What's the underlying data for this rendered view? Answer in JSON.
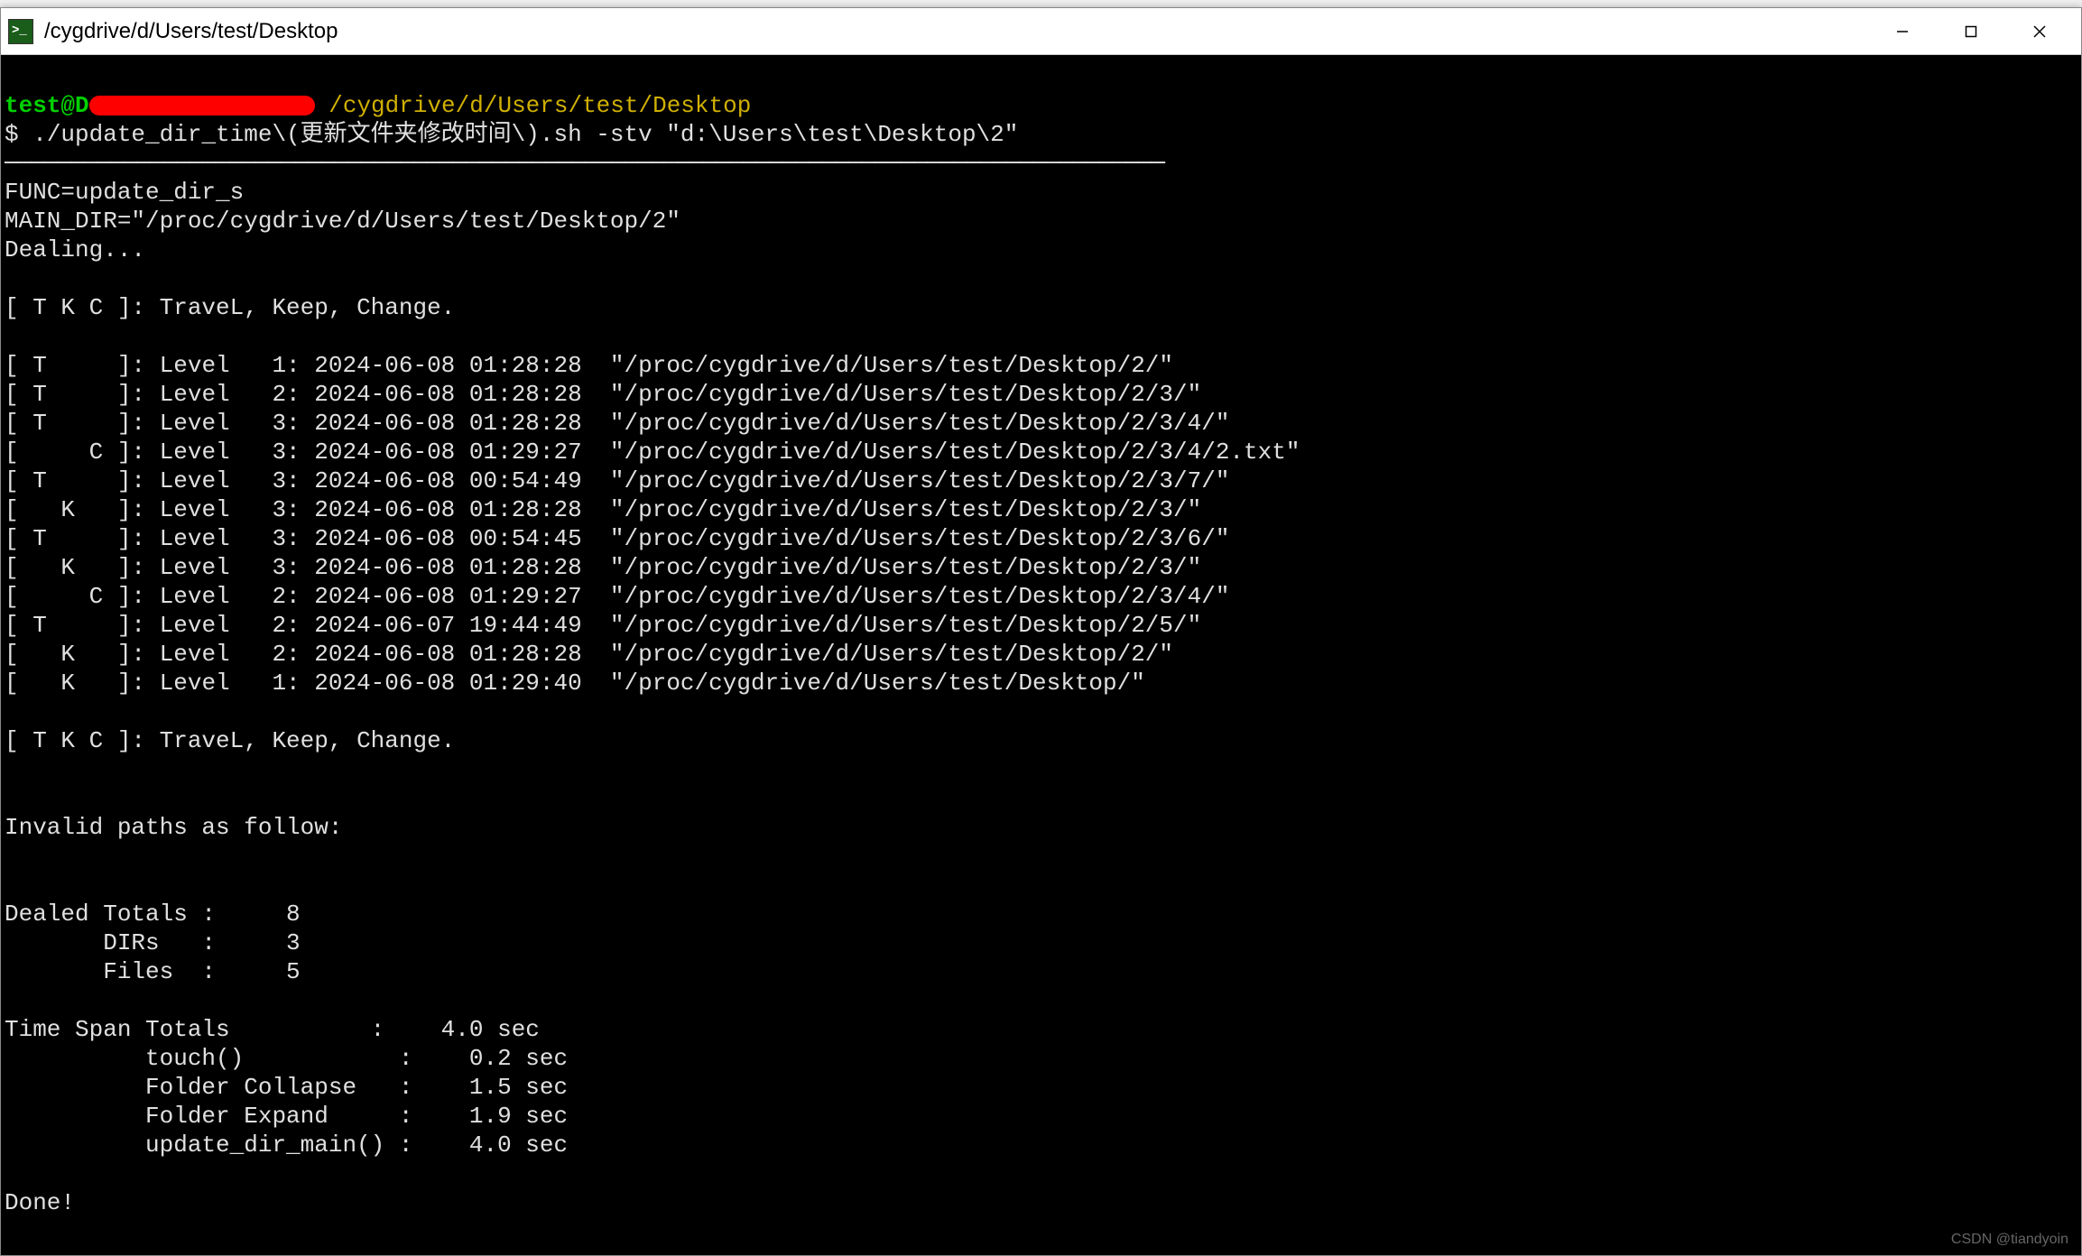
{
  "window": {
    "title": "/cygdrive/d/Users/test/Desktop"
  },
  "prompt": {
    "user": "test@D",
    "path": "/cygdrive/d/Users/test/Desktop",
    "symbol": "$",
    "command": "./update_dir_time\\(更新文件夹修改时间\\).sh -stv \"d:\\Users\\test\\Desktop\\2\""
  },
  "sep": "────────────────────────────────────────────────────────────────────────────────────────",
  "header": {
    "func": "FUNC=update_dir_s",
    "main_dir": "MAIN_DIR=\"/proc/cygdrive/d/Users/test/Desktop/2\"",
    "dealing": "Dealing..."
  },
  "legend": "[ T K C ]: TraveL, Keep, Change.",
  "rows": [
    {
      "tag": "[ T     ]:",
      "rest": " Level   1: 2024-06-08 01:28:28  \"/proc/cygdrive/d/Users/test/Desktop/2/\""
    },
    {
      "tag": "[ T     ]:",
      "rest": " Level   2: 2024-06-08 01:28:28  \"/proc/cygdrive/d/Users/test/Desktop/2/3/\""
    },
    {
      "tag": "[ T     ]:",
      "rest": " Level   3: 2024-06-08 01:28:28  \"/proc/cygdrive/d/Users/test/Desktop/2/3/4/\""
    },
    {
      "tag": "[     C ]:",
      "rest": " Level   3: 2024-06-08 01:29:27  \"/proc/cygdrive/d/Users/test/Desktop/2/3/4/2.txt\""
    },
    {
      "tag": "[ T     ]:",
      "rest": " Level   3: 2024-06-08 00:54:49  \"/proc/cygdrive/d/Users/test/Desktop/2/3/7/\""
    },
    {
      "tag": "[   K   ]:",
      "rest": " Level   3: 2024-06-08 01:28:28  \"/proc/cygdrive/d/Users/test/Desktop/2/3/\""
    },
    {
      "tag": "[ T     ]:",
      "rest": " Level   3: 2024-06-08 00:54:45  \"/proc/cygdrive/d/Users/test/Desktop/2/3/6/\""
    },
    {
      "tag": "[   K   ]:",
      "rest": " Level   3: 2024-06-08 01:28:28  \"/proc/cygdrive/d/Users/test/Desktop/2/3/\""
    },
    {
      "tag": "[     C ]:",
      "rest": " Level   2: 2024-06-08 01:29:27  \"/proc/cygdrive/d/Users/test/Desktop/2/3/4/\""
    },
    {
      "tag": "[ T     ]:",
      "rest": " Level   2: 2024-06-07 19:44:49  \"/proc/cygdrive/d/Users/test/Desktop/2/5/\""
    },
    {
      "tag": "[   K   ]:",
      "rest": " Level   2: 2024-06-08 01:28:28  \"/proc/cygdrive/d/Users/test/Desktop/2/\""
    },
    {
      "tag": "[   K   ]:",
      "rest": " Level   1: 2024-06-08 01:29:40  \"/proc/cygdrive/d/Users/test/Desktop/\""
    }
  ],
  "invalid": "Invalid paths as follow:",
  "totals": {
    "dealed": "Dealed Totals :     8",
    "dirs": "       DIRs   :     3",
    "files": "       Files  :     5"
  },
  "timespan": {
    "total": "Time Span Totals          :    4.0 sec",
    "touch": "          touch()           :    0.2 sec",
    "collapse": "          Folder Collapse   :    1.5 sec",
    "expand": "          Folder Expand     :    1.9 sec",
    "main": "          update_dir_main() :    4.0 sec"
  },
  "done": "Done!",
  "watermark": "CSDN @tiandyoin"
}
